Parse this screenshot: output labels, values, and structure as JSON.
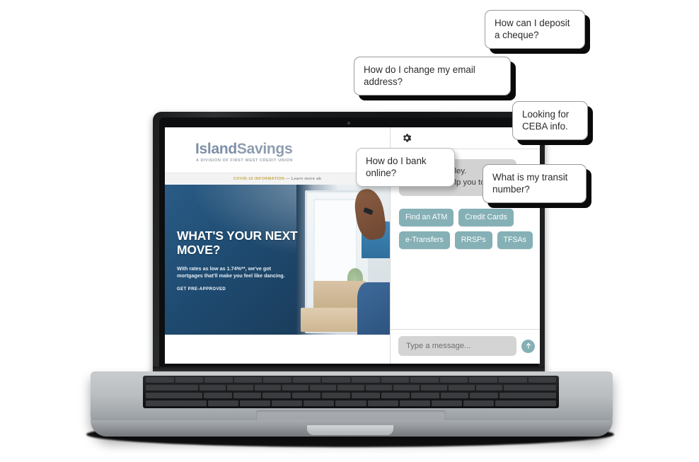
{
  "laptop": {
    "device_name": "laptop-mockup"
  },
  "website": {
    "logo": {
      "part1": "Island",
      "part2": "Savings",
      "tagline": "A DIVISION OF FIRST WEST CREDIT UNION"
    },
    "covid_banner": {
      "label": "COVID-19 INFORMATION",
      "dash": " — ",
      "link": "Learn more ab"
    },
    "hero": {
      "headline": "WHAT'S YOUR NEXT MOVE?",
      "subtext": "With rates as low as 1.74%**, we've got mortgages that'll make you feel like dancing.",
      "cta": "GET PRE-APPROVED"
    }
  },
  "chat": {
    "header": {
      "settings_icon": "gear-icon",
      "close_icon": "close-icon",
      "close_glyph": "✕"
    },
    "greeting": "Hello, I’m Finley.\nHow can I help you today?",
    "greeting_line1": "Hello, I’m Finley.",
    "greeting_line2": "How can I help you today?",
    "quick_replies": [
      "Find an ATM",
      "Credit Cards",
      "e-Transfers",
      "RRSPs",
      "TFSAs"
    ],
    "input_placeholder": "Type a message...",
    "input_value": "",
    "send_icon": "send-arrow-up-icon",
    "accent_color": "#84b0b6",
    "bubble_color": "#d2d2d2"
  },
  "floating_questions": [
    {
      "text": "How can I deposit a cheque?"
    },
    {
      "text": "How do I change my email address?"
    },
    {
      "text": "Looking for CEBA info."
    },
    {
      "text": "What is my transit number?"
    },
    {
      "text": "How do I bank online?"
    }
  ]
}
